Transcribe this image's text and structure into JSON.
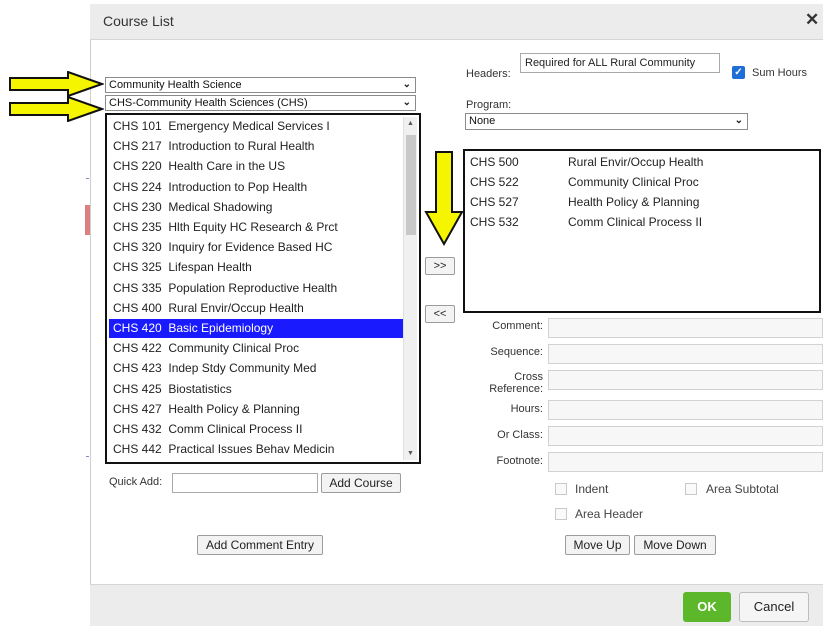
{
  "dialog": {
    "title": "Course List",
    "close_label": "✕"
  },
  "dropdowns": {
    "department": "Community Health Science",
    "subject": "CHS-Community Health Sciences (CHS)"
  },
  "courses": [
    {
      "code": "CHS 101",
      "title": "Emergency Medical Services I"
    },
    {
      "code": "CHS 217",
      "title": "Introduction to Rural Health"
    },
    {
      "code": "CHS 220",
      "title": "Health Care in the US"
    },
    {
      "code": "CHS 224",
      "title": "Introduction to Pop Health"
    },
    {
      "code": "CHS 230",
      "title": "Medical Shadowing"
    },
    {
      "code": "CHS 235",
      "title": "Hlth Equity HC Research & Prct"
    },
    {
      "code": "CHS 320",
      "title": "Inquiry for Evidence Based HC"
    },
    {
      "code": "CHS 325",
      "title": "Lifespan Health"
    },
    {
      "code": "CHS 335",
      "title": "Population Reproductive Health"
    },
    {
      "code": "CHS 400",
      "title": "Rural Envir/Occup Health"
    },
    {
      "code": "CHS 420",
      "title": "Basic Epidemiology",
      "selected": true
    },
    {
      "code": "CHS 422",
      "title": "Community Clinical Proc"
    },
    {
      "code": "CHS 423",
      "title": "Indep Stdy Community Med"
    },
    {
      "code": "CHS 425",
      "title": "Biostatistics"
    },
    {
      "code": "CHS 427",
      "title": "Health Policy & Planning"
    },
    {
      "code": "CHS 432",
      "title": "Comm Clinical Process II"
    },
    {
      "code": "CHS 442",
      "title": "Practical Issues Behav Medicin"
    }
  ],
  "quick_add": {
    "label": "Quick Add:",
    "value": "",
    "button": "Add Course"
  },
  "add_comment_button": "Add Comment Entry",
  "move_right_label": ">>",
  "move_left_label": "<<",
  "headers": {
    "label": "Headers:",
    "value": "Required for ALL Rural Community"
  },
  "sum_hours": {
    "label": "Sum Hours",
    "checked": true
  },
  "program": {
    "label": "Program:",
    "value": "None"
  },
  "selected_courses": [
    {
      "code": "CHS 500",
      "title": "Rural Envir/Occup Health"
    },
    {
      "code": "CHS 522",
      "title": "Community Clinical Proc"
    },
    {
      "code": "CHS 527",
      "title": "Health Policy & Planning"
    },
    {
      "code": "CHS 532",
      "title": "Comm Clinical Process II"
    }
  ],
  "form": {
    "comment": "Comment:",
    "sequence": "Sequence:",
    "cross_reference_1": "Cross",
    "cross_reference_2": "Reference:",
    "hours": "Hours:",
    "or_class": "Or Class:",
    "footnote": "Footnote:"
  },
  "checkboxes": {
    "indent": "Indent",
    "area_subtotal": "Area Subtotal",
    "area_header": "Area Header"
  },
  "move_up": "Move Up",
  "move_down": "Move Down",
  "ok": "OK",
  "cancel": "Cancel",
  "colors": {
    "highlight_arrow": "#f5f500",
    "selection": "#1a1aff",
    "ok_green": "#5cb82a"
  }
}
